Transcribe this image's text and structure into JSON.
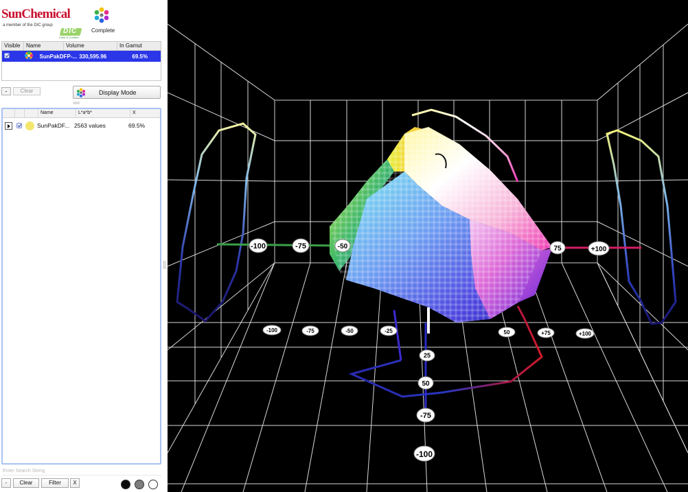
{
  "brand": {
    "name": "SunChemical",
    "subtitle": "a member of the DIC group",
    "dic_logo_text": "DIC",
    "dic_tagline": "Color & Comfort",
    "app_logo_text": "Complete"
  },
  "gamut_table": {
    "columns": [
      "Visible",
      "Name",
      "Volume",
      "In Gamut"
    ],
    "rows": [
      {
        "visible": true,
        "name": "SunPakDFP-...",
        "volume": "330,595.96",
        "in_gamut": "69.5%"
      }
    ]
  },
  "toolbar": {
    "minus_label": "-",
    "clear_label": "Clear",
    "display_mode_label": "Display Mode"
  },
  "measurement_list": {
    "columns": [
      "",
      "",
      "",
      "Name",
      "L*a*b*",
      "X"
    ],
    "rows": [
      {
        "name": "SunPakDF...",
        "values": "2563 values",
        "x": "69.5%",
        "swatch_color": "#f2e66e"
      }
    ]
  },
  "search": {
    "placeholder": "Enter Search String"
  },
  "bottom_bar": {
    "minus_label": "-",
    "clear_label": "Clear",
    "filter_label": "Filter",
    "x_label": "X",
    "background_modes": [
      "#0b0b0b",
      "#7e7e7e",
      "#ffffff"
    ]
  },
  "viewport": {
    "background": "#000000",
    "a_axis_ticks": [
      "-100",
      "-75",
      "-50",
      "75",
      "+100"
    ],
    "b_axis_ticks": [
      "-100",
      "-75",
      "-50",
      "-25",
      "50",
      "+75",
      "+100"
    ],
    "l_axis_ticks": [
      "25",
      "50",
      "-75",
      "-100"
    ]
  }
}
